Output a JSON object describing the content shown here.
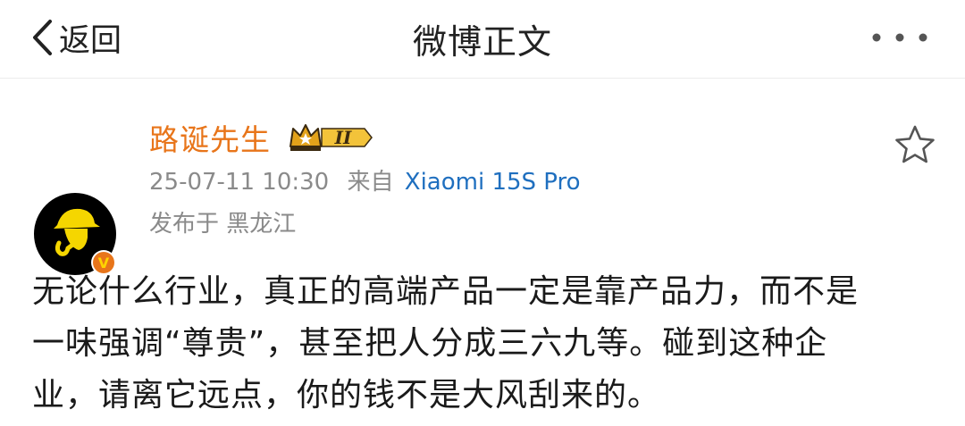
{
  "navbar": {
    "back_label": "返回",
    "title": "微博正文",
    "more_icon": "more-dots-icon"
  },
  "post": {
    "author": {
      "name": "路诞先生",
      "badge_text": "II",
      "verified_mark": "V"
    },
    "timestamp": "25-07-11 10:30",
    "source_prefix": "来自",
    "source": "Xiaomi 15S Pro",
    "location": "发布于 黑龙江",
    "text_lines": [
      "无论什么行业，真正的高端产品一定是靠产品力，而不是",
      "一味强调“尊贵”，甚至把人分成三六九等。碰到这种企",
      "业，请离它远点，你的钱不是大风刮来的。"
    ]
  },
  "colors": {
    "author_name": "#e8751a",
    "source_link": "#1f6fbf",
    "meta_gray": "#8a8a8a",
    "badge_gold": "#e3a21a"
  }
}
